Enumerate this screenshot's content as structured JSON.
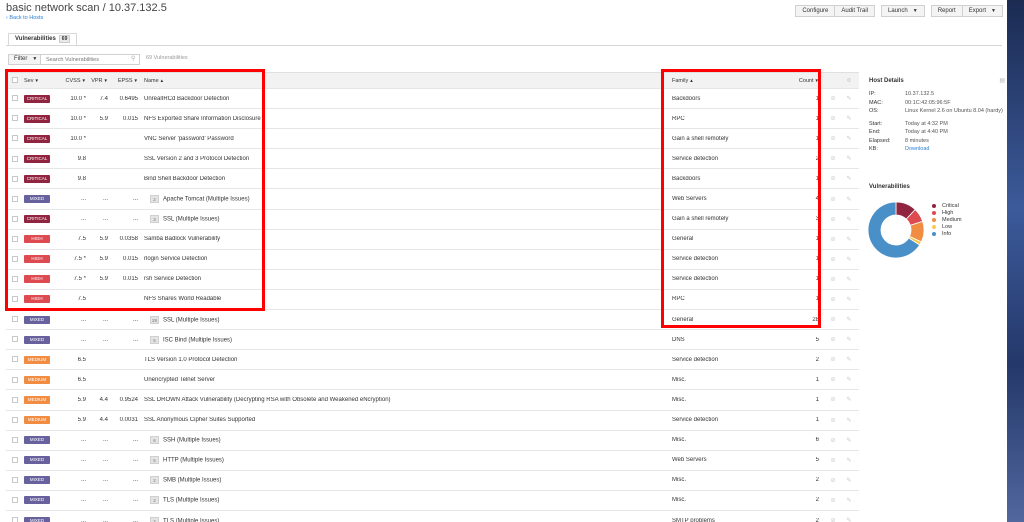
{
  "header": {
    "title": "basic network scan / 10.37.132.5",
    "back_link": "‹ Back to Hosts",
    "buttons": {
      "configure": "Configure",
      "audit_trail": "Audit Trail",
      "launch": "Launch",
      "report": "Report",
      "export": "Export"
    }
  },
  "tab": {
    "label": "Vulnerabilities",
    "count": "69"
  },
  "toolbar": {
    "filter_label": "Filter",
    "search_placeholder": "Search Vulnerabilities",
    "result_count": "69 Vulnerabilities"
  },
  "table": {
    "headers": {
      "sev": "Sev",
      "cvss": "CVSS",
      "vpr": "VPR",
      "epss": "EPSS",
      "name": "Name",
      "family": "Family",
      "count": "Count"
    },
    "rows": [
      {
        "sev": "CRITICAL",
        "cls": "s-critical",
        "cvss": "10.0 *",
        "vpr": "7.4",
        "epss": "0.6495",
        "name": "UnrealIRCd Backdoor Detection",
        "group": "",
        "family": "Backdoors",
        "count": "1"
      },
      {
        "sev": "CRITICAL",
        "cls": "s-critical",
        "cvss": "10.0 *",
        "vpr": "5.9",
        "epss": "0.015",
        "name": "NFS Exported Share Information Disclosure",
        "group": "",
        "family": "RPC",
        "count": "1"
      },
      {
        "sev": "CRITICAL",
        "cls": "s-critical",
        "cvss": "10.0 *",
        "vpr": "",
        "epss": "",
        "name": "VNC Server 'password' Password",
        "group": "",
        "family": "Gain a shell remotely",
        "count": "1"
      },
      {
        "sev": "CRITICAL",
        "cls": "s-critical",
        "cvss": "9.8",
        "vpr": "",
        "epss": "",
        "name": "SSL Version 2 and 3 Protocol Detection",
        "group": "",
        "family": "Service detection",
        "count": "2"
      },
      {
        "sev": "CRITICAL",
        "cls": "s-critical",
        "cvss": "9.8",
        "vpr": "",
        "epss": "",
        "name": "Bind Shell Backdoor Detection",
        "group": "",
        "family": "Backdoors",
        "count": "1"
      },
      {
        "sev": "MIXED",
        "cls": "s-mixed",
        "cvss": "...",
        "vpr": "...",
        "epss": "...",
        "name": "Apache Tomcat (Multiple Issues)",
        "group": "2",
        "family": "Web Servers",
        "count": "4"
      },
      {
        "sev": "CRITICAL",
        "cls": "s-critical",
        "cvss": "...",
        "vpr": "...",
        "epss": "...",
        "name": "SSL (Multiple Issues)",
        "group": "3",
        "family": "Gain a shell remotely",
        "count": "3"
      },
      {
        "sev": "HIGH",
        "cls": "s-high",
        "cvss": "7.5",
        "vpr": "5.9",
        "epss": "0.0358",
        "name": "Samba Badlock Vulnerability",
        "group": "",
        "family": "General",
        "count": "1"
      },
      {
        "sev": "HIGH",
        "cls": "s-high",
        "cvss": "7.5 *",
        "vpr": "5.9",
        "epss": "0.015",
        "name": "rlogin Service Detection",
        "group": "",
        "family": "Service detection",
        "count": "1"
      },
      {
        "sev": "HIGH",
        "cls": "s-high",
        "cvss": "7.5 *",
        "vpr": "5.9",
        "epss": "0.015",
        "name": "rsh Service Detection",
        "group": "",
        "family": "Service detection",
        "count": "1"
      },
      {
        "sev": "HIGH",
        "cls": "s-high",
        "cvss": "7.5",
        "vpr": "",
        "epss": "",
        "name": "NFS Shares World Readable",
        "group": "",
        "family": "RPC",
        "count": "1"
      },
      {
        "sev": "MIXED",
        "cls": "s-mixed",
        "cvss": "...",
        "vpr": "...",
        "epss": "...",
        "name": "SSL (Multiple Issues)",
        "group": "28",
        "family": "General",
        "count": "28"
      },
      {
        "sev": "MIXED",
        "cls": "s-mixed",
        "cvss": "...",
        "vpr": "...",
        "epss": "...",
        "name": "ISC Bind (Multiple Issues)",
        "group": "5",
        "family": "DNS",
        "count": "5"
      },
      {
        "sev": "MEDIUM",
        "cls": "s-medium",
        "cvss": "6.5",
        "vpr": "",
        "epss": "",
        "name": "TLS Version 1.0 Protocol Detection",
        "group": "",
        "family": "Service detection",
        "count": "2"
      },
      {
        "sev": "MEDIUM",
        "cls": "s-medium",
        "cvss": "6.5",
        "vpr": "",
        "epss": "",
        "name": "Unencrypted Telnet Server",
        "group": "",
        "family": "Misc.",
        "count": "1"
      },
      {
        "sev": "MEDIUM",
        "cls": "s-medium",
        "cvss": "5.9",
        "vpr": "4.4",
        "epss": "0.9524",
        "name": "SSL DROWN Attack Vulnerability (Decrypting RSA with Obsolete and Weakened eNcryption)",
        "group": "",
        "family": "Misc.",
        "count": "1"
      },
      {
        "sev": "MEDIUM",
        "cls": "s-medium",
        "cvss": "5.9",
        "vpr": "4.4",
        "epss": "0.0031",
        "name": "SSL Anonymous Cipher Suites Supported",
        "group": "",
        "family": "Service detection",
        "count": "1"
      },
      {
        "sev": "MIXED",
        "cls": "s-mixed",
        "cvss": "...",
        "vpr": "...",
        "epss": "...",
        "name": "SSH (Multiple Issues)",
        "group": "6",
        "family": "Misc.",
        "count": "6"
      },
      {
        "sev": "MIXED",
        "cls": "s-mixed",
        "cvss": "...",
        "vpr": "...",
        "epss": "...",
        "name": "HTTP (Multiple Issues)",
        "group": "5",
        "family": "Web Servers",
        "count": "5"
      },
      {
        "sev": "MIXED",
        "cls": "s-mixed",
        "cvss": "...",
        "vpr": "...",
        "epss": "...",
        "name": "SMB (Multiple Issues)",
        "group": "2",
        "family": "Misc.",
        "count": "2"
      },
      {
        "sev": "MIXED",
        "cls": "s-mixed",
        "cvss": "...",
        "vpr": "...",
        "epss": "...",
        "name": "TLS (Multiple Issues)",
        "group": "2",
        "family": "Misc.",
        "count": "2"
      },
      {
        "sev": "MIXED",
        "cls": "s-mixed",
        "cvss": "...",
        "vpr": "...",
        "epss": "...",
        "name": "TLS (Multiple Issues)",
        "group": "2",
        "family": "SMTP problems",
        "count": "2"
      }
    ]
  },
  "host_details": {
    "title": "Host Details",
    "fields": [
      {
        "key": "IP:",
        "value": "10.37.132.5"
      },
      {
        "key": "MAC:",
        "value": "00:1C:42:05:96:5F"
      },
      {
        "key": "OS:",
        "value": "Linux Kernel 2.6 on Ubuntu 8.04 (hardy)"
      },
      {
        "key": "Start:",
        "value": "Today at 4:32 PM"
      },
      {
        "key": "End:",
        "value": "Today at 4:40 PM"
      },
      {
        "key": "Elapsed:",
        "value": "8 minutes"
      },
      {
        "key": "KB:",
        "value": "Download"
      }
    ]
  },
  "vuln_summary": {
    "title": "Vulnerabilities",
    "legend": [
      {
        "label": "Critical",
        "color": "#91243e"
      },
      {
        "label": "High",
        "color": "#dd4b50"
      },
      {
        "label": "Medium",
        "color": "#f18c43"
      },
      {
        "label": "Low",
        "color": "#f8c851"
      },
      {
        "label": "Info",
        "color": "#4a90c8"
      }
    ],
    "donut_fractions": [
      0.12,
      0.08,
      0.12,
      0.02,
      0.66
    ]
  },
  "colors": {
    "critical": "#91243e",
    "high": "#dd4b50",
    "medium": "#f18c43",
    "mixed": "#67629e",
    "link": "#2a7fd3",
    "highlight": "#ff0000"
  }
}
